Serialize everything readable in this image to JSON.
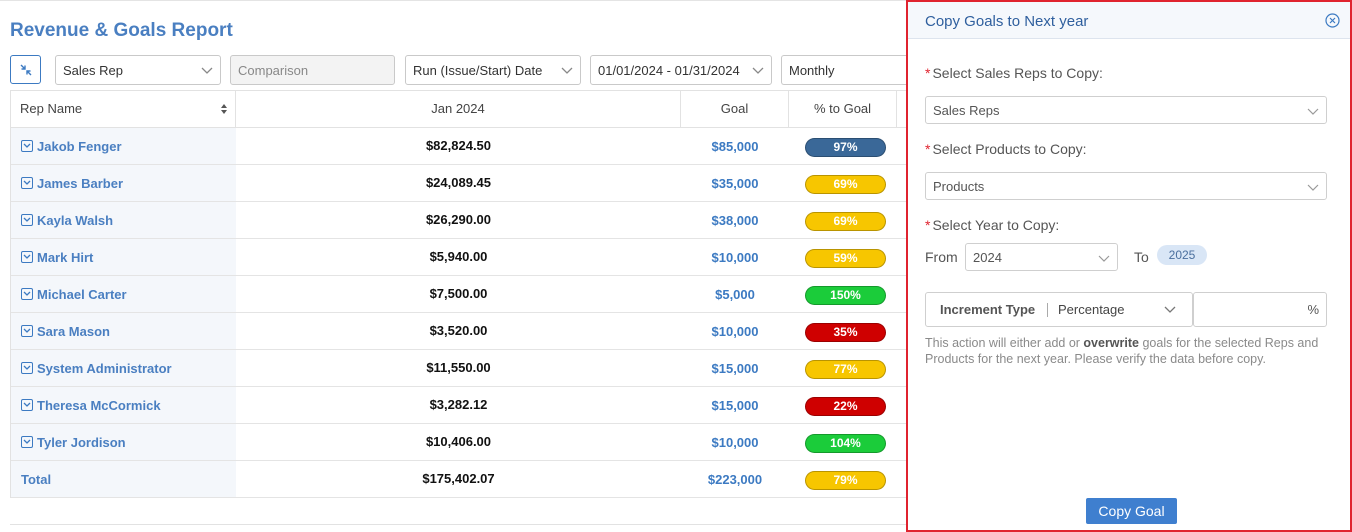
{
  "report": {
    "title": "Revenue & Goals Report",
    "toolbar": {
      "group_by": "Sales Rep",
      "comparison_placeholder": "Comparison",
      "date_type": "Run (Issue/Start) Date",
      "date_range": "01/01/2024 - 01/31/2024",
      "interval": "Monthly"
    },
    "columns": {
      "name": "Rep Name",
      "period": "Jan 2024",
      "goal": "Goal",
      "pct": "% to Goal"
    },
    "rows": [
      {
        "name": "Jakob Fenger",
        "value": "$82,824.50",
        "goal": "$85,000",
        "pct": "97%",
        "color": "#3a6898"
      },
      {
        "name": "James Barber",
        "value": "$24,089.45",
        "goal": "$35,000",
        "pct": "69%",
        "color": "#f7c600"
      },
      {
        "name": "Kayla Walsh",
        "value": "$26,290.00",
        "goal": "$38,000",
        "pct": "69%",
        "color": "#f7c600"
      },
      {
        "name": "Mark Hirt",
        "value": "$5,940.00",
        "goal": "$10,000",
        "pct": "59%",
        "color": "#f7c600"
      },
      {
        "name": "Michael Carter",
        "value": "$7,500.00",
        "goal": "$5,000",
        "pct": "150%",
        "color": "#1bcc3a"
      },
      {
        "name": "Sara Mason",
        "value": "$3,520.00",
        "goal": "$10,000",
        "pct": "35%",
        "color": "#cf0000"
      },
      {
        "name": "System Administrator",
        "value": "$11,550.00",
        "goal": "$15,000",
        "pct": "77%",
        "color": "#f7c600"
      },
      {
        "name": "Theresa McCormick",
        "value": "$3,282.12",
        "goal": "$15,000",
        "pct": "22%",
        "color": "#cf0000"
      },
      {
        "name": "Tyler Jordison",
        "value": "$10,406.00",
        "goal": "$10,000",
        "pct": "104%",
        "color": "#1bcc3a"
      }
    ],
    "total": {
      "name": "Total",
      "value": "$175,402.07",
      "goal": "$223,000",
      "pct": "79%",
      "color": "#f7c600"
    }
  },
  "panel": {
    "title": "Copy Goals to Next year",
    "reps_label": "Select Sales Reps to Copy:",
    "reps_value": "Sales Reps",
    "products_label": "Select Products to Copy:",
    "products_value": "Products",
    "year_label": "Select Year to Copy:",
    "from_label": "From",
    "from_year": "2024",
    "to_label": "To",
    "to_year": "2025",
    "increment_label": "Increment Type",
    "increment_value": "Percentage",
    "pct_unit": "%",
    "note_before": "This action will either add or ",
    "note_bold": "overwrite",
    "note_after": " goals for the selected Reps and Products for the next year. Please verify the data before copy.",
    "copy_button": "Copy Goal"
  },
  "colors": {
    "accent": "#3f7fcf",
    "highlight_border": "#e0232f"
  }
}
